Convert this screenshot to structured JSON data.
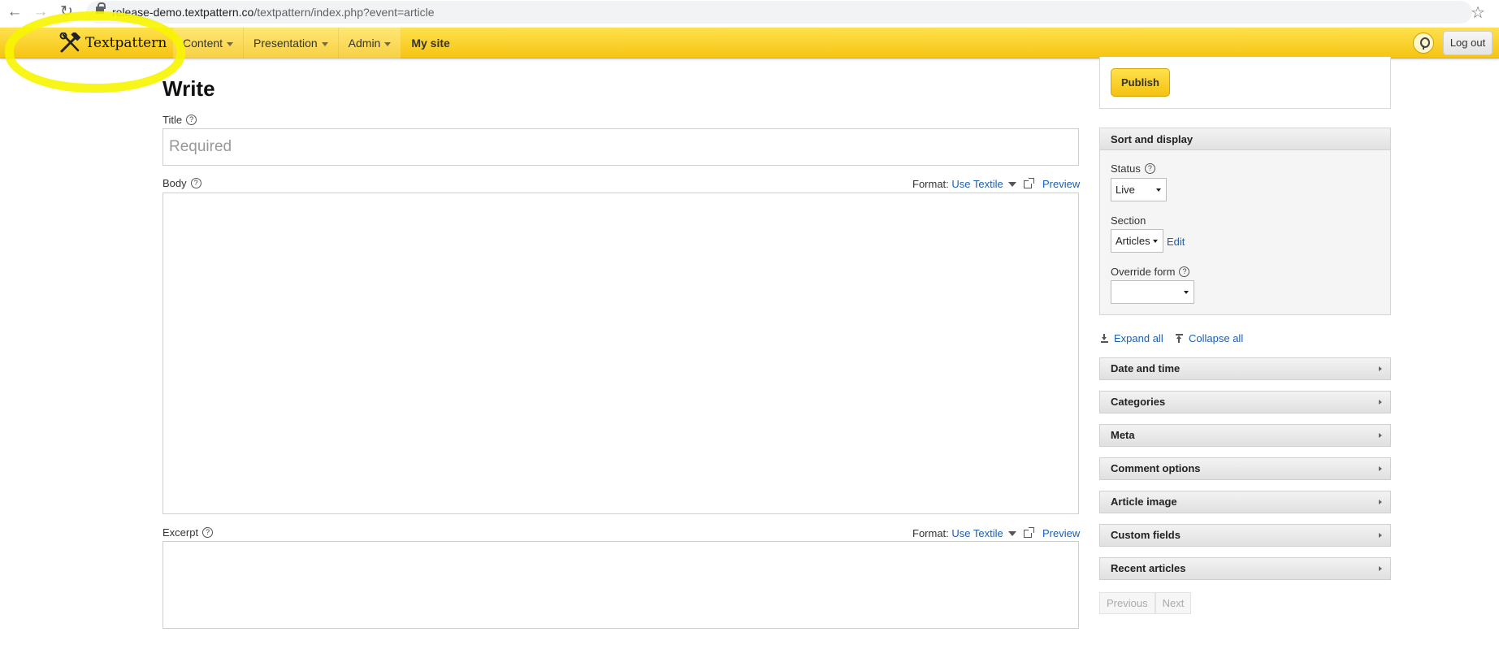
{
  "browser": {
    "url_host": "release-demo.textpattern.co",
    "url_path": "/textpattern/index.php?event=article",
    "back_icon": "arrow-left-icon",
    "forward_icon": "arrow-right-icon",
    "reload_icon": "reload-icon",
    "star_icon": "star-icon"
  },
  "header": {
    "brand": "Textpattern",
    "nav": [
      "Content",
      "Presentation",
      "Admin"
    ],
    "site_link": "My site",
    "logout": "Log out",
    "accent": "#ffcc00"
  },
  "main": {
    "title": "Write",
    "title_label": "Title",
    "title_placeholder": "Required",
    "body_label": "Body",
    "excerpt_label": "Excerpt",
    "format_prefix": "Format:",
    "format_value": "Use Textile",
    "preview": "Preview",
    "help_glyph": "?"
  },
  "sidebar": {
    "publish": "Publish",
    "sort_title": "Sort and display",
    "status_label": "Status",
    "status_value": "Live",
    "section_label": "Section",
    "section_value": "Articles",
    "edit": "Edit",
    "override_label": "Override form",
    "override_value": "",
    "expand_all": "Expand all",
    "collapse_all": "Collapse all",
    "sections": [
      "Date and time",
      "Categories",
      "Meta",
      "Comment options",
      "Article image",
      "Custom fields",
      "Recent articles"
    ],
    "prev": "Previous",
    "next": "Next"
  }
}
